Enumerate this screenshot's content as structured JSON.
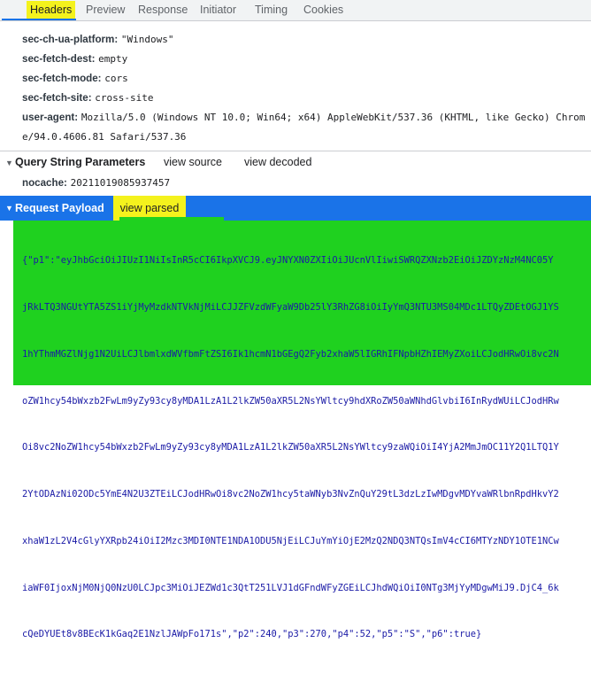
{
  "tabs": [
    {
      "label": "Headers"
    },
    {
      "label": "Preview"
    },
    {
      "label": "Response"
    },
    {
      "label": "Initiator"
    },
    {
      "label": "Timing"
    },
    {
      "label": "Cookies"
    }
  ],
  "headers": [
    {
      "key": "sec-ch-ua-platform:",
      "value": "\"Windows\""
    },
    {
      "key": "sec-fetch-dest:",
      "value": "empty"
    },
    {
      "key": "sec-fetch-mode:",
      "value": "cors"
    },
    {
      "key": "sec-fetch-site:",
      "value": "cross-site"
    },
    {
      "key": "user-agent:",
      "value": "Mozilla/5.0 (Windows NT 10.0; Win64; x64) AppleWebKit/537.36 (KHTML, like Gecko) Chrom",
      "value_cont": "e/94.0.4606.81 Safari/537.36"
    }
  ],
  "query_section": {
    "title": "Query String Parameters",
    "view_source": "view source",
    "view_decoded": "view decoded",
    "params": [
      {
        "key": "nocache:",
        "value": "20211019085937457"
      }
    ]
  },
  "payload_section": {
    "title": "Request Payload",
    "view_parsed": "view parsed",
    "body_lines": [
      "{\"p1\":\"eyJhbGciOiJIUzI1NiIsInR5cCI6IkpXVCJ9.eyJNYXN0ZXIiOiJUcnVlIiwiSWRQZXNzb2EiOiJZDYzNzM4NC05Y",
      "jRkLTQ3NGUtYTA5ZS1iYjMyMzdkNTVkNjMiLCJJZFVzdWFyaW9Db25lY3RhZG8iOiIyYmQ3NTU3MS04MDc1LTQyZDEtOGJ1YS",
      "1hYThmMGZlNjg1N2UiLCJlbmlxdWVfbmFtZSI6Ik1hcmN1bGEgQ2Fyb2xhaW5lIGRhIFNpbHZhIEMyZXoiLCJodHRwOi8vc2N",
      "oZW1hcy54bWxzb2FwLm9yZy93cy8yMDA1LzA1L2lkZW50aXR5L2NsYWltcy9hdXRoZW50aWNhdGlvbiI6InRydWUiLCJodHRw",
      "Oi8vc2NoZW1hcy54bWxzb2FwLm9yZy93cy8yMDA1LzA1L2lkZW50aXR5L2NsYWltcy9zaWQiOiI4YjA2MmJmOC11Y2Q1LTQ1Y",
      "2YtODAzNi02ODc5YmE4N2U3ZTEiLCJodHRwOi8vc2NoZW1hcy5taWNyb3NvZnQuY29tL3dzLzIwMDgvMDYvaWRlbnRpdHkvY2",
      "xhaW1zL2V4cGlyYXRpb24iOiI2Mzc3MDI0NTE1NDA1ODU5NjEiLCJuYmYiOjE2MzQ2NDQ3NTQsImV4cCI6MTYzNDY1OTE1NCw",
      "iaWF0IjoxNjM0NjQ0NzU0LCJpc3MiOiJEZWd1c3QtT251LVJ1dGFndWFyZGEiLCJhdWQiOiI0NTg3MjYyMDgwMiJ9.DjC4_6k",
      "cQeDYUEt8v8BEcK1kGaq2E1NzlJAWpFo171s\",\"p2\":240,\"p3\":270,\"p4\":52,\"p5\":\"S\",\"p6\":true}"
    ]
  },
  "colors": {
    "highlight_yellow": "#f4f21d",
    "highlight_green": "#1fd11f",
    "payload_header_blue": "#1a73e8"
  }
}
